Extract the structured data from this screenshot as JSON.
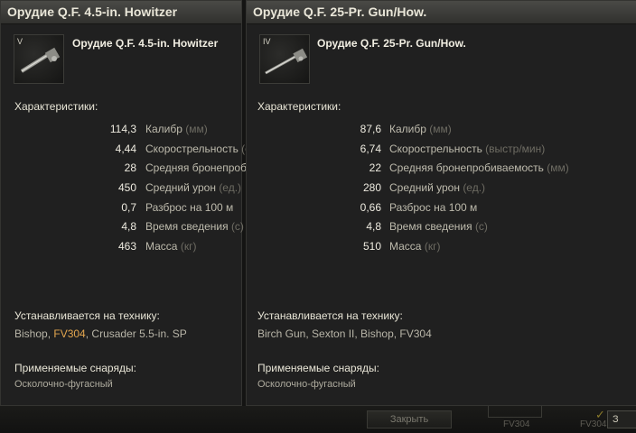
{
  "left": {
    "title": "Орудие Q.F. 4.5-in. Howitzer",
    "tier": "V",
    "gun_name": "Орудие Q.F. 4.5-in. Howitzer",
    "characteristics_label": "Характеристики:",
    "stats": [
      {
        "value": "114,3",
        "label": "Калибр",
        "unit": "(мм)"
      },
      {
        "value": "4,44",
        "label": "Скорострельность",
        "unit": "(с"
      },
      {
        "value": "28",
        "label": "Средняя бронепроби",
        "unit": ""
      },
      {
        "value": "450",
        "label": "Средний урон",
        "unit": "(ед.)"
      },
      {
        "value": "0,7",
        "label": "Разброс на 100 м",
        "unit": ""
      },
      {
        "value": "4,8",
        "label": "Время сведения",
        "unit": "(с)"
      },
      {
        "value": "463",
        "label": "Масса",
        "unit": "(кг)"
      }
    ],
    "installed_label": "Устанавливается на технику:",
    "vehicles": [
      {
        "name": "Bishop",
        "highlight": false
      },
      {
        "name": "FV304",
        "highlight": true
      },
      {
        "name": "Crusader 5.5-in. SP",
        "highlight": false
      }
    ],
    "ammo_label": "Применяемые снаряды:",
    "ammo": "Осколочно-фугасный"
  },
  "right": {
    "title": "Орудие Q.F. 25-Pr. Gun/How.",
    "tier": "IV",
    "gun_name": "Орудие Q.F. 25-Pr. Gun/How.",
    "characteristics_label": "Характеристики:",
    "stats": [
      {
        "value": "87,6",
        "label": "Калибр",
        "unit": "(мм)"
      },
      {
        "value": "6,74",
        "label": "Скорострельность",
        "unit": "(выстр/мин)"
      },
      {
        "value": "22",
        "label": "Средняя бронепробиваемость",
        "unit": "(мм)"
      },
      {
        "value": "280",
        "label": "Средний урон",
        "unit": "(ед.)"
      },
      {
        "value": "0,66",
        "label": "Разброс на 100 м",
        "unit": ""
      },
      {
        "value": "4,8",
        "label": "Время сведения",
        "unit": "(с)"
      },
      {
        "value": "510",
        "label": "Масса",
        "unit": "(кг)"
      }
    ],
    "installed_label": "Устанавливается на технику:",
    "vehicles_text": "Birch Gun, Sexton II, Bishop, FV304",
    "ammo_label": "Применяемые снаряды:",
    "ammo": "Осколочно-фугасный"
  },
  "background": {
    "close_label": "Закрыть",
    "vehicle_a": "FV304",
    "vehicle_b": "FV304",
    "button3_label": "З"
  },
  "colors": {
    "highlight": "#e3a64f",
    "header": "#3d3d3a",
    "panel": "#202020"
  }
}
